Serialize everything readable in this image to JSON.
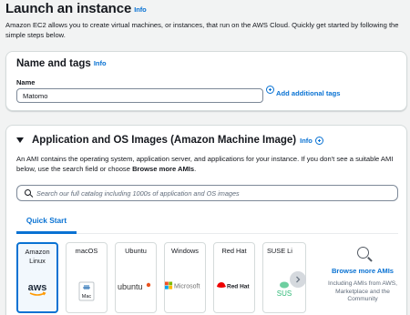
{
  "header": {
    "title": "Launch an instance",
    "info": "Info",
    "description": "Amazon EC2 allows you to create virtual machines, or instances, that run on the AWS Cloud. Quickly get started by following the simple steps below."
  },
  "name_tags": {
    "title": "Name and tags",
    "info": "Info",
    "name_label": "Name",
    "name_value": "Matomo",
    "add_tags": "Add additional tags"
  },
  "ami": {
    "title": "Application and OS Images (Amazon Machine Image)",
    "info": "Info",
    "description_prefix": "An AMI contains the operating system, application server, and applications for your instance. If you don't see a suitable AMI below, use the search field or choose ",
    "description_bold": "Browse more AMIs",
    "description_suffix": ".",
    "search_placeholder": "Search our full catalog including 1000s of application and OS images",
    "tabs": [
      {
        "label": "Quick Start",
        "selected": true
      }
    ],
    "os_options": [
      {
        "label": "Amazon Linux",
        "logo_text": "aws",
        "icon": "aws-logo-icon",
        "selected": true
      },
      {
        "label": "macOS",
        "logo_text": "Mac",
        "icon": "mac-logo-icon",
        "selected": false
      },
      {
        "label": "Ubuntu",
        "logo_text": "ubuntu",
        "icon": "ubuntu-logo-icon",
        "selected": false
      },
      {
        "label": "Windows",
        "logo_text": "Microsoft",
        "icon": "windows-logo-icon",
        "selected": false
      },
      {
        "label": "Red Hat",
        "logo_text": "Red Hat",
        "icon": "redhat-logo-icon",
        "selected": false
      },
      {
        "label": "SUSE Li",
        "logo_text": "SUS",
        "icon": "suse-logo-icon",
        "selected": false
      }
    ],
    "browse_more": {
      "link": "Browse more AMIs",
      "sub": "Including AMIs from AWS, Marketplace and the Community"
    }
  },
  "colors": {
    "link": "#0972d3",
    "background": "#f2f3f3",
    "panel": "#ffffff",
    "text": "#16191f"
  }
}
